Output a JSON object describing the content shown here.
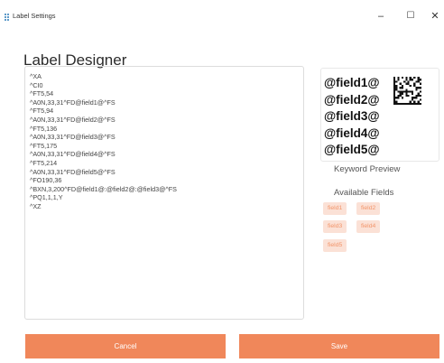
{
  "window": {
    "title": "Label Settings",
    "minimize_glyph": "–",
    "maximize_glyph": "☐",
    "close_glyph": "✕"
  },
  "page": {
    "title": "Label Designer"
  },
  "editor": {
    "lines": [
      "^XA",
      "^CI0",
      "^FT5,54",
      "^A0N,33,31^FD@field1@^FS",
      "^FT5,94",
      "^A0N,33,31^FD@field2@^FS",
      "^FT5,136",
      "^A0N,33,31^FD@field3@^FS",
      "^FT5,175",
      "^A0N,33,31^FD@field4@^FS",
      "^FT5,214",
      "^A0N,33,31^FD@field5@^FS",
      "^FO190,36",
      "^BXN,3,200^FD@field1@:@field2@:@field3@^FS",
      "^PQ1,1,1,Y",
      "^XZ"
    ]
  },
  "preview": {
    "fields": [
      "@field1@",
      "@field2@",
      "@field3@",
      "@field4@",
      "@field5@"
    ],
    "barcode_icon": "datamatrix-barcode-icon"
  },
  "keyword_preview_label": "Keyword Preview",
  "available_fields": {
    "label": "Available Fields",
    "tags": [
      "field1",
      "field2",
      "field3",
      "field4",
      "field5"
    ]
  },
  "actions": {
    "cancel": "Cancel",
    "save": "Save"
  },
  "colors": {
    "accent": "#f0875a",
    "tag_bg": "#fbe1d6",
    "tag_text": "#f2956a",
    "app_icon": "#2a7ab8"
  }
}
